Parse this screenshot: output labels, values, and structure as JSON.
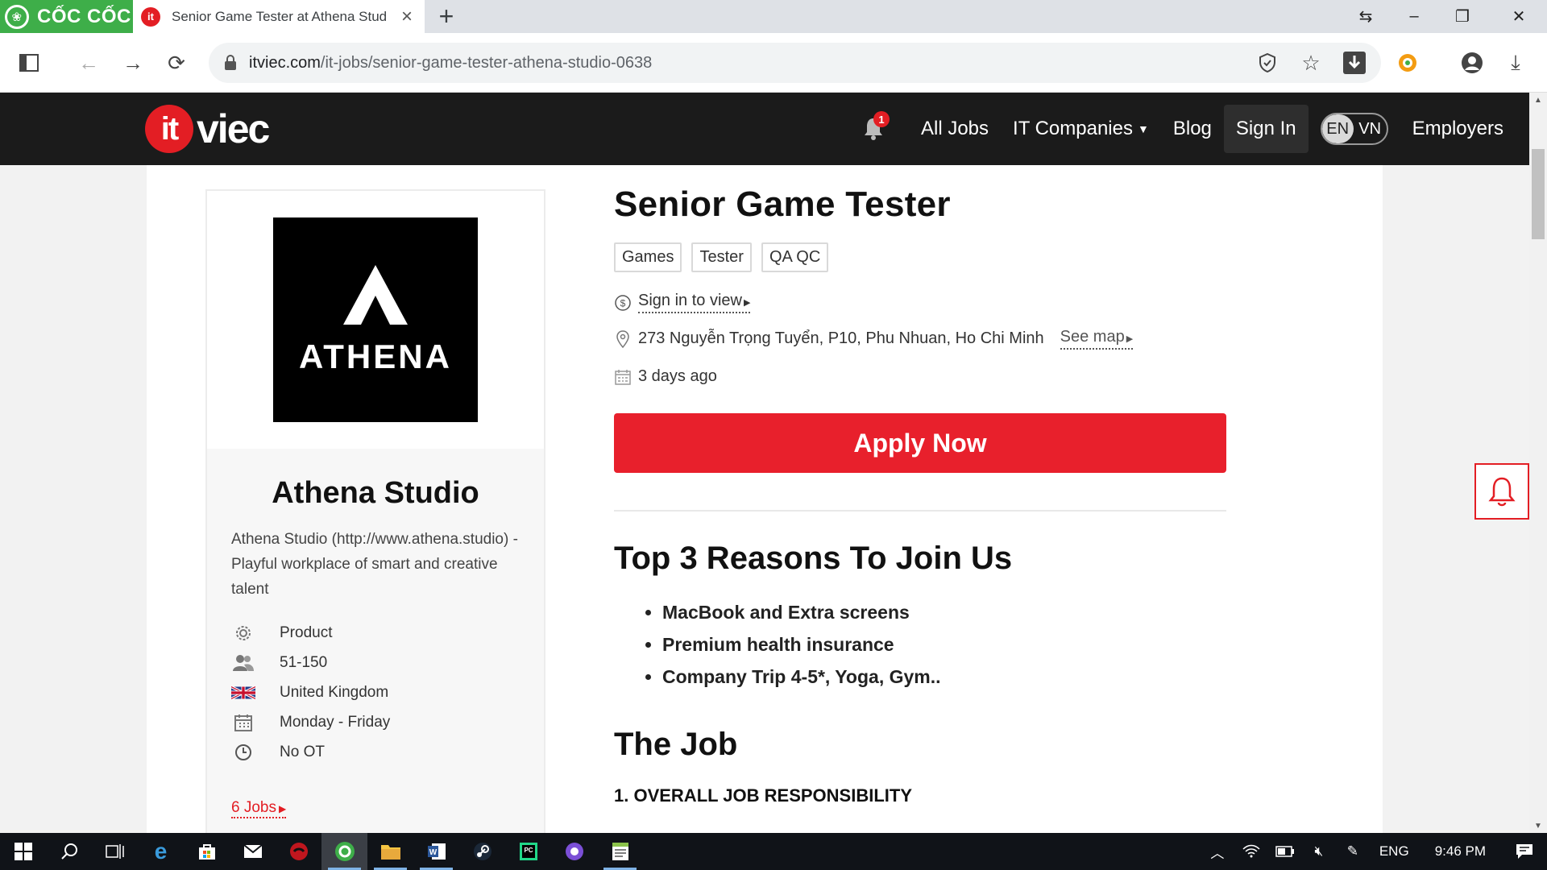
{
  "browser": {
    "brand": "CỐC CỐC",
    "tab_title": "Senior Game Tester at Athena Stud",
    "url_host": "itviec.com",
    "url_path": "/it-jobs/senior-game-tester-athena-studio-0638"
  },
  "site": {
    "logo_it": "it",
    "logo_viec": "viec",
    "notification_count": "1",
    "nav": {
      "all_jobs": "All Jobs",
      "it_companies": "IT Companies",
      "blog": "Blog",
      "sign_in": "Sign In",
      "lang_en": "EN",
      "lang_vn": "VN",
      "employers": "Employers"
    }
  },
  "company": {
    "logo_text": "ATHENA",
    "name": "Athena Studio",
    "description": "Athena Studio (http://www.athena.studio) - Playful workplace of smart and creative talent",
    "info": [
      {
        "icon": "gear-icon",
        "text": "Product"
      },
      {
        "icon": "people-icon",
        "text": "51-150"
      },
      {
        "icon": "uk-flag-icon",
        "text": "United Kingdom"
      },
      {
        "icon": "calendar-icon",
        "text": "Monday - Friday"
      },
      {
        "icon": "clock-icon",
        "text": "No OT"
      }
    ],
    "jobs_link": "6 Jobs"
  },
  "job": {
    "title": "Senior Game Tester",
    "tags": [
      "Games",
      "Tester",
      "QA QC"
    ],
    "salary": "Sign in to view",
    "address": "273 Nguyễn Trọng Tuyển, P10, Phu Nhuan, Ho Chi Minh",
    "see_map": "See map",
    "posted": "3 days ago",
    "apply": "Apply Now",
    "reasons_title": "Top 3 Reasons To Join Us",
    "reasons": [
      "MacBook and Extra screens",
      "Premium health insurance",
      "Company Trip 4-5*, Yoga, Gym.."
    ],
    "job_title_section": "The Job",
    "sub_heading": "1. OVERALL JOB RESPONSIBILITY"
  },
  "taskbar": {
    "lang": "ENG",
    "time": "9:46 PM"
  },
  "colors": {
    "accent_red": "#e31e24",
    "header_bg": "#1b1b1b",
    "browser_green": "#3eae49"
  }
}
